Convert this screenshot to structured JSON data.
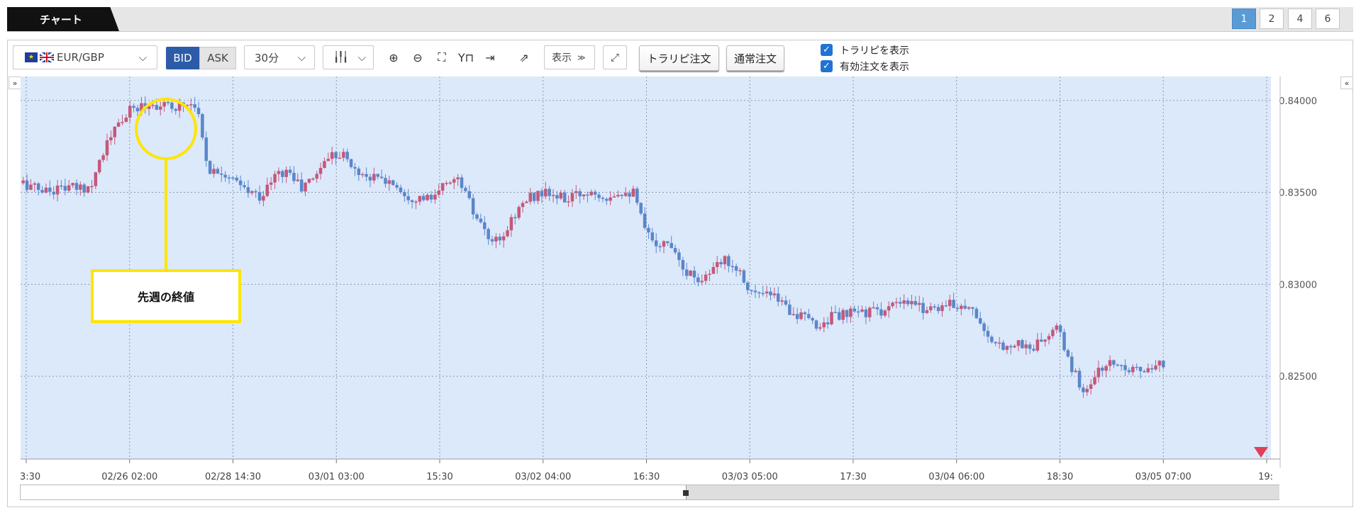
{
  "header": {
    "active_tab": "チャート",
    "layout_buttons": [
      "1",
      "2",
      "4",
      "6"
    ]
  },
  "toolbar": {
    "symbol": "EUR/GBP",
    "bid_label": "BID",
    "ask_label": "ASK",
    "timeframe": "30分",
    "display_label": "表示",
    "trap_order_label": "トラリピ注文",
    "normal_order_label": "通常注文",
    "show_trap_label": "トラリピを表示",
    "show_valid_orders_label": "有効注文を表示"
  },
  "annotation": {
    "label": "先週の終値"
  },
  "colors": {
    "up": "#c4587a",
    "down": "#5b86c9",
    "plot_bg": "#dce9fb",
    "highlight": "#ffe500"
  },
  "chart_data": {
    "type": "candlestick",
    "symbol": "EUR/GBP",
    "timeframe": "30分",
    "price_type": "BID",
    "ylim": [
      0.8205,
      0.8413
    ],
    "y_ticks": [
      "0.84000",
      "0.83500",
      "0.83000",
      "0.82500"
    ],
    "x_ticks": [
      "3:30",
      "02/26 02:00",
      "02/28 14:30",
      "03/01 03:00",
      "15:30",
      "03/02 04:00",
      "16:30",
      "03/03 05:00",
      "17:30",
      "03/04 06:00",
      "18:30",
      "03/05 07:00",
      "19:"
    ],
    "annotated_point": {
      "label": "先週の終値",
      "close": 0.8399
    },
    "close_path": [
      0.8355,
      0.8352,
      0.8351,
      0.8353,
      0.8352,
      0.8353,
      0.8372,
      0.8385,
      0.8394,
      0.8397,
      0.8398,
      0.8396,
      0.8398,
      0.8399,
      0.8362,
      0.8362,
      0.8355,
      0.835,
      0.8348,
      0.8359,
      0.8362,
      0.8352,
      0.8359,
      0.837,
      0.8372,
      0.8362,
      0.8359,
      0.8357,
      0.8355,
      0.8348,
      0.8347,
      0.8346,
      0.8357,
      0.8356,
      0.8338,
      0.8325,
      0.8322,
      0.8338,
      0.8346,
      0.835,
      0.8348,
      0.8346,
      0.8349,
      0.8351,
      0.8348,
      0.8351,
      0.835,
      0.8327,
      0.8322,
      0.8322,
      0.8307,
      0.8303,
      0.8307,
      0.8314,
      0.8308,
      0.8295,
      0.8294,
      0.8292,
      0.8285,
      0.8281,
      0.8277,
      0.8283,
      0.8283,
      0.8285,
      0.8285,
      0.8286,
      0.8289,
      0.8289,
      0.8287,
      0.8288,
      0.8289,
      0.8289,
      0.8283,
      0.8266,
      0.8267,
      0.8268,
      0.8265,
      0.827,
      0.8276,
      0.8256,
      0.8241,
      0.8252,
      0.8257,
      0.8256,
      0.8254,
      0.8252,
      0.8257
    ]
  }
}
